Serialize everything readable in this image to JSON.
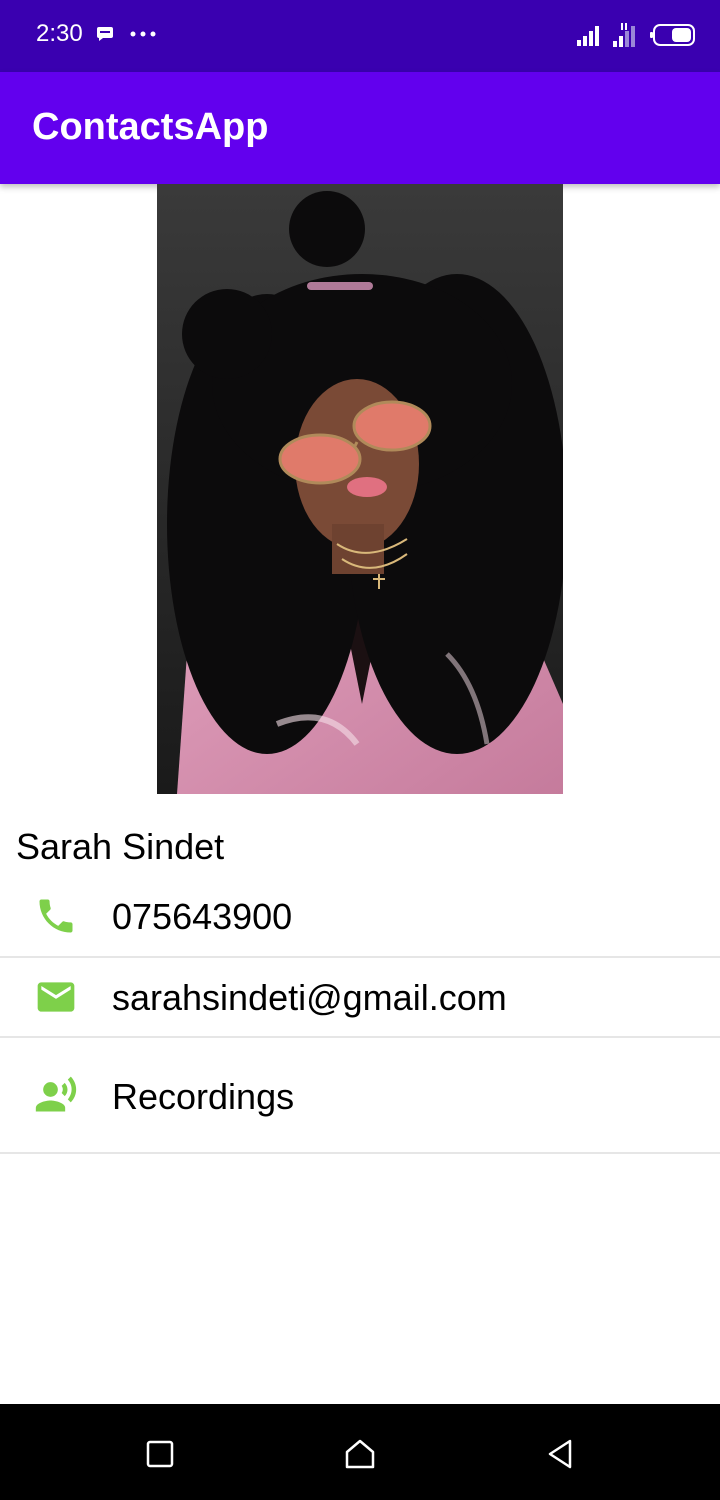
{
  "status_bar": {
    "time": "2:30",
    "icons_left": [
      "message-icon",
      "more-dots-icon"
    ],
    "icons_right": [
      "signal-icon",
      "signal-4g-icon",
      "battery-icon"
    ]
  },
  "app_bar": {
    "title": "ContactsApp",
    "color": "#6200ee",
    "status_color": "#3a00b0"
  },
  "contact": {
    "name": "Sarah Sindet",
    "phone": "075643900",
    "email": "sarahsindeti@gmail.com",
    "recordings_label": "Recordings",
    "photo_icon": "contact-photo"
  },
  "accent_color": "#7ed04a",
  "nav_bar": {
    "buttons": [
      "recents-icon",
      "home-icon",
      "back-icon"
    ]
  }
}
